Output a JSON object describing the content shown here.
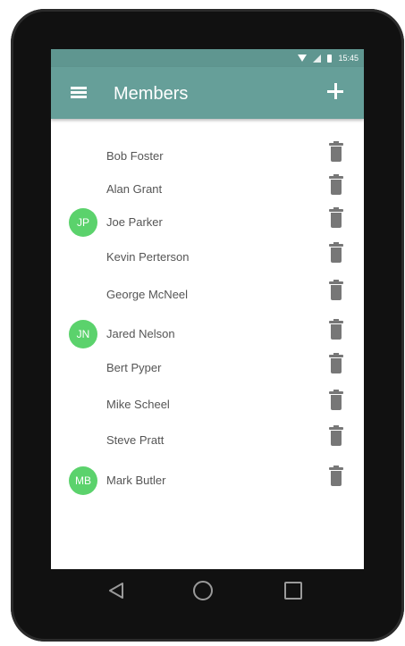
{
  "status_bar": {
    "time": "15:45",
    "icons": [
      "wifi-icon",
      "signal-icon",
      "battery-icon"
    ]
  },
  "app_bar": {
    "title": "Members",
    "menu_icon": "menu-icon",
    "add_icon": "add-icon"
  },
  "members": [
    {
      "name": "Bob Foster",
      "initials": ""
    },
    {
      "name": "Alan Grant",
      "initials": ""
    },
    {
      "name": "Joe Parker",
      "initials": "JP"
    },
    {
      "name": "Kevin Perterson",
      "initials": ""
    },
    {
      "name": "George McNeel",
      "initials": ""
    },
    {
      "name": "Jared Nelson",
      "initials": "JN"
    },
    {
      "name": "Bert Pyper",
      "initials": ""
    },
    {
      "name": "Mike Scheel",
      "initials": ""
    },
    {
      "name": "Steve Pratt",
      "initials": ""
    },
    {
      "name": "Mark Butler",
      "initials": "MB"
    }
  ],
  "nav_bar": {
    "icons": [
      "back-icon",
      "home-icon",
      "recents-icon"
    ]
  },
  "colors": {
    "app_bar": "#669f99",
    "status_bar": "#5f9690",
    "avatar": "#5bd26c",
    "trash": "#777777"
  }
}
